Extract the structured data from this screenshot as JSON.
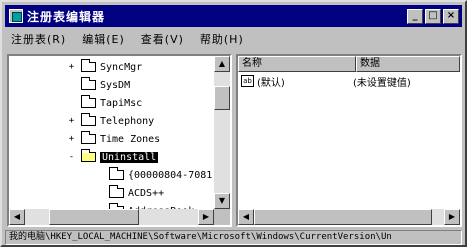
{
  "window": {
    "title": "注册表编辑器",
    "controls": {
      "minimize": "_",
      "maximize": "□",
      "close": "×"
    }
  },
  "menu": [
    {
      "label": "注册表(R)"
    },
    {
      "label": "编辑(E)"
    },
    {
      "label": "查看(V)"
    },
    {
      "label": "帮助(H)"
    }
  ],
  "tree": {
    "items": [
      {
        "label": "SyncMgr",
        "expander": "+"
      },
      {
        "label": "SysDM",
        "expander": ""
      },
      {
        "label": "TapiMsc",
        "expander": ""
      },
      {
        "label": "Telephony",
        "expander": "+"
      },
      {
        "label": "Time Zones",
        "expander": "+"
      },
      {
        "label": "Uninstall",
        "expander": "-"
      },
      {
        "label": "{00000804-7081-",
        "expander": ""
      },
      {
        "label": "ACDS++",
        "expander": ""
      },
      {
        "label": "AddressBook",
        "expander": ""
      }
    ]
  },
  "list": {
    "headers": {
      "name": "名称",
      "data": "数据"
    },
    "rows": [
      {
        "name": "(默认)",
        "data": "(未设置键值)",
        "icon": "ab"
      }
    ]
  },
  "status": "我的电脑\\HKEY_LOCAL_MACHINE\\Software\\Microsoft\\Windows\\CurrentVersion\\Un"
}
